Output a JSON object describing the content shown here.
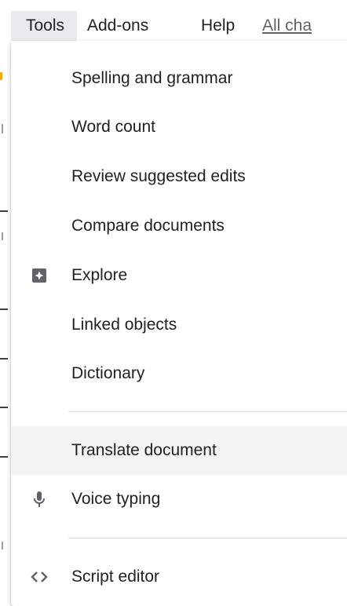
{
  "menubar": {
    "items": [
      {
        "label": "Tools"
      },
      {
        "label": "Add-ons"
      },
      {
        "label": "Help"
      },
      {
        "label": "All cha"
      }
    ]
  },
  "tools_menu": {
    "items": [
      {
        "label": "Spelling and grammar"
      },
      {
        "label": "Word count"
      },
      {
        "label": "Review suggested edits"
      },
      {
        "label": "Compare documents"
      },
      {
        "label": "Explore",
        "icon": "explore-icon"
      },
      {
        "label": "Linked objects"
      },
      {
        "label": "Dictionary"
      },
      {
        "label": "Translate document"
      },
      {
        "label": "Voice typing",
        "icon": "microphone-icon"
      },
      {
        "label": "Script editor",
        "icon": "code-icon"
      }
    ]
  },
  "colors": {
    "highlight": "#f1f3f4",
    "active_menubar": "#e8eaed",
    "text": "#202124",
    "icon": "#5f6368",
    "separator": "#dadce0"
  }
}
